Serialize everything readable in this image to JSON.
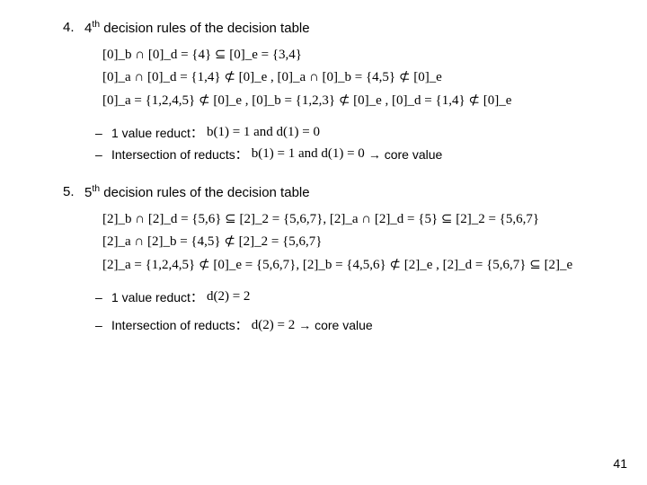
{
  "item4": {
    "num": "4.",
    "title_pre": "4",
    "title_sup": "th",
    "title_rest": " decision rules of the decision table",
    "math_line1": "[0]_b ∩ [0]_d = {4} ⊆ [0]_e = {3,4}",
    "math_line2": "[0]_a ∩ [0]_d = {1,4} ⊄ [0]_e ,  [0]_a ∩ [0]_b = {4,5} ⊄ [0]_e",
    "math_line3": "[0]_a = {1,2,4,5} ⊄ [0]_e ,  [0]_b = {1,2,3} ⊄ [0]_e ,  [0]_d = {1,4} ⊄ [0]_e",
    "sub1_label": "1 value reduct：",
    "sub1_math": "b(1) = 1 and d(1) = 0",
    "sub2_label": "Intersection of reducts：",
    "sub2_math": "b(1) = 1 and d(1) = 0",
    "sub2_tail": " → core value"
  },
  "item5": {
    "num": "5.",
    "title_pre": "5",
    "title_sup": "th",
    "title_rest": " decision rules of the decision table",
    "math_line1": "[2]_b ∩ [2]_d = {5,6} ⊆ [2]_2 = {5,6,7},  [2]_a ∩ [2]_d = {5} ⊆ [2]_2 = {5,6,7}",
    "math_line2": "[2]_a ∩ [2]_b = {4,5} ⊄ [2]_2 = {5,6,7}",
    "math_line3": "[2]_a = {1,2,4,5} ⊄ [0]_e = {5,6,7},  [2]_b = {4,5,6} ⊄ [2]_e ,  [2]_d = {5,6,7} ⊆ [2]_e",
    "sub1_label": "1 value reduct：",
    "sub1_math": "d(2) = 2",
    "sub2_label": "Intersection of reducts：",
    "sub2_math": "d(2) = 2",
    "sub2_tail": "→ core value"
  },
  "slide_number": "41",
  "dash": "–"
}
